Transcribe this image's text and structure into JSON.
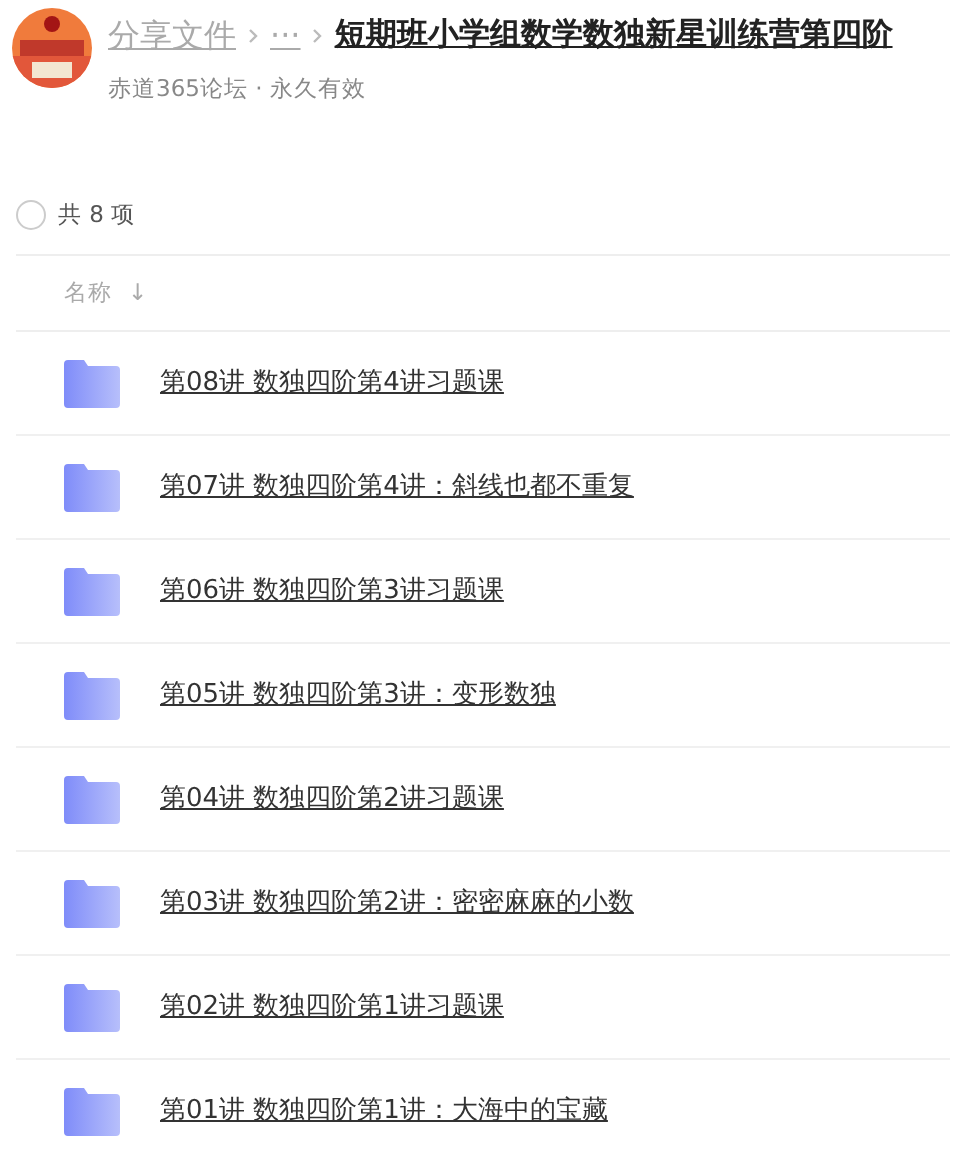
{
  "breadcrumb": [
    {
      "label": "分享文件"
    },
    {
      "label": "···"
    },
    {
      "label": "短期班小学组数学数独新星训练营第四阶"
    }
  ],
  "meta": "赤道365论坛 · 永久有效",
  "select_all": {
    "checked": false,
    "label": "共 8 项"
  },
  "column": {
    "label": "名称",
    "sort_arrow": "↓"
  },
  "files": [
    {
      "name": "第08讲 数独四阶第4讲习题课"
    },
    {
      "name": "第07讲 数独四阶第4讲：斜线也都不重复"
    },
    {
      "name": "第06讲 数独四阶第3讲习题课"
    },
    {
      "name": "第05讲 数独四阶第3讲：变形数独"
    },
    {
      "name": "第04讲 数独四阶第2讲习题课"
    },
    {
      "name": "第03讲 数独四阶第2讲：密密麻麻的小数"
    },
    {
      "name": "第02讲 数独四阶第1讲习题课"
    },
    {
      "name": "第01讲 数独四阶第1讲：大海中的宝藏"
    }
  ]
}
